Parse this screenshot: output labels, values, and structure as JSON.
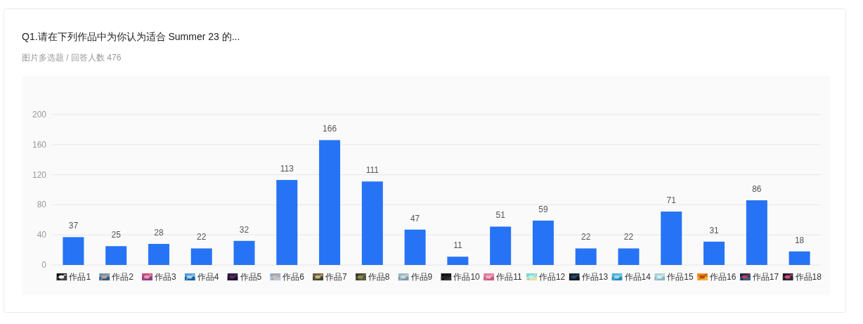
{
  "question": {
    "title": "Q1.请在下列作品中为你认为适合 Summer 23 的...",
    "meta": "图片多选题 / 回答人数 476"
  },
  "chart": {
    "chart_data": {
      "type": "bar",
      "categories": [
        "作品1",
        "作品2",
        "作品3",
        "作品4",
        "作品5",
        "作品6",
        "作品7",
        "作品8",
        "作品9",
        "作品10",
        "作品11",
        "作品12",
        "作品13",
        "作品14",
        "作品15",
        "作品16",
        "作品17",
        "作品18"
      ],
      "series": [
        {
          "color": "#2673f5",
          "values": [
            37,
            25,
            28,
            22,
            32,
            113,
            166,
            111,
            47,
            11,
            51,
            59,
            22,
            22,
            71,
            31,
            86,
            18
          ]
        }
      ],
      "ylim": [
        0,
        200
      ],
      "yticks": [
        0,
        40,
        80,
        120,
        160,
        200
      ],
      "data_labels": true,
      "grid": true
    }
  }
}
